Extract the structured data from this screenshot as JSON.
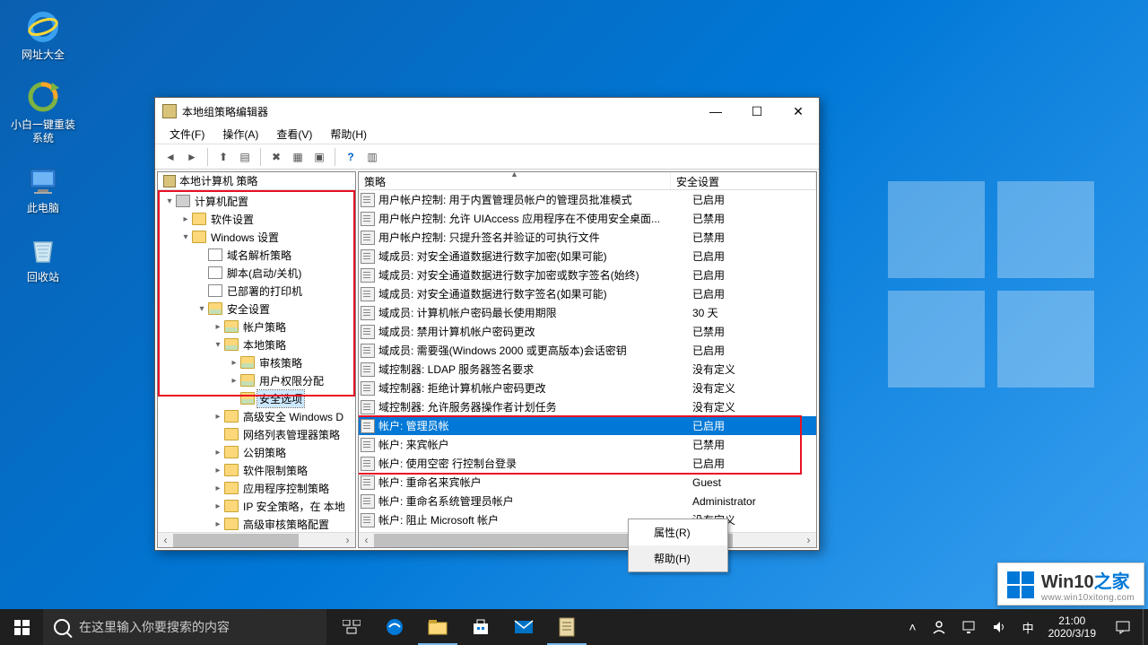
{
  "desktop_icons": [
    {
      "name": "browser",
      "label": "网址大全"
    },
    {
      "name": "reinstall",
      "label": "小白一键重装系统"
    },
    {
      "name": "this-pc",
      "label": "此电脑"
    },
    {
      "name": "recycle-bin",
      "label": "回收站"
    }
  ],
  "window": {
    "title": "本地组策略编辑器",
    "menus": [
      "文件(F)",
      "操作(A)",
      "查看(V)",
      "帮助(H)"
    ]
  },
  "tree": {
    "root": "本地计算机 策略",
    "nodes": [
      {
        "depth": 0,
        "tw": "open",
        "ico": "pc",
        "label": "计算机配置"
      },
      {
        "depth": 1,
        "tw": "closed",
        "ico": "folder",
        "label": "软件设置"
      },
      {
        "depth": 1,
        "tw": "open",
        "ico": "folder",
        "label": "Windows 设置"
      },
      {
        "depth": 2,
        "tw": "none",
        "ico": "doc",
        "label": "域名解析策略"
      },
      {
        "depth": 2,
        "tw": "none",
        "ico": "doc",
        "label": "脚本(启动/关机)"
      },
      {
        "depth": 2,
        "tw": "none",
        "ico": "doc",
        "label": "已部署的打印机"
      },
      {
        "depth": 2,
        "tw": "open",
        "ico": "sec",
        "label": "安全设置"
      },
      {
        "depth": 3,
        "tw": "closed",
        "ico": "sec",
        "label": "帐户策略"
      },
      {
        "depth": 3,
        "tw": "open",
        "ico": "sec",
        "label": "本地策略"
      },
      {
        "depth": 4,
        "tw": "closed",
        "ico": "sec",
        "label": "审核策略"
      },
      {
        "depth": 4,
        "tw": "closed",
        "ico": "sec",
        "label": "用户权限分配"
      },
      {
        "depth": 4,
        "tw": "none",
        "ico": "sec",
        "label": "安全选项",
        "selected": true
      },
      {
        "depth": 3,
        "tw": "closed",
        "ico": "folder",
        "label": "高级安全 Windows D"
      },
      {
        "depth": 3,
        "tw": "none",
        "ico": "folder",
        "label": "网络列表管理器策略"
      },
      {
        "depth": 3,
        "tw": "closed",
        "ico": "folder",
        "label": "公钥策略"
      },
      {
        "depth": 3,
        "tw": "closed",
        "ico": "folder",
        "label": "软件限制策略"
      },
      {
        "depth": 3,
        "tw": "closed",
        "ico": "folder",
        "label": "应用程序控制策略"
      },
      {
        "depth": 3,
        "tw": "closed",
        "ico": "folder",
        "label": "IP 安全策略，在 本地"
      },
      {
        "depth": 3,
        "tw": "closed",
        "ico": "folder",
        "label": "高级审核策略配置"
      }
    ]
  },
  "list": {
    "columns": [
      "策略",
      "安全设置"
    ],
    "rows": [
      {
        "p": "用户帐户控制: 用于内置管理员帐户的管理员批准模式",
        "s": "已启用"
      },
      {
        "p": "用户帐户控制: 允许 UIAccess 应用程序在不使用安全桌面...",
        "s": "已禁用"
      },
      {
        "p": "用户帐户控制: 只提升签名并验证的可执行文件",
        "s": "已禁用"
      },
      {
        "p": "域成员: 对安全通道数据进行数字加密(如果可能)",
        "s": "已启用"
      },
      {
        "p": "域成员: 对安全通道数据进行数字加密或数字签名(始终)",
        "s": "已启用"
      },
      {
        "p": "域成员: 对安全通道数据进行数字签名(如果可能)",
        "s": "已启用"
      },
      {
        "p": "域成员: 计算机帐户密码最长使用期限",
        "s": "30 天"
      },
      {
        "p": "域成员: 禁用计算机帐户密码更改",
        "s": "已禁用"
      },
      {
        "p": "域成员: 需要强(Windows 2000 或更高版本)会话密钥",
        "s": "已启用"
      },
      {
        "p": "域控制器: LDAP 服务器签名要求",
        "s": "没有定义"
      },
      {
        "p": "域控制器: 拒绝计算机帐户密码更改",
        "s": "没有定义"
      },
      {
        "p": "域控制器: 允许服务器操作者计划任务",
        "s": "没有定义"
      },
      {
        "p": "帐户: 管理员帐",
        "s": "已启用",
        "selected": true
      },
      {
        "p": "帐户: 来宾帐户",
        "s": "已禁用"
      },
      {
        "p": "帐户: 使用空密                                      行控制台登录",
        "s": "已启用"
      },
      {
        "p": "帐户: 重命名来宾帐户",
        "s": "Guest"
      },
      {
        "p": "帐户: 重命名系统管理员帐户",
        "s": "Administrator"
      },
      {
        "p": "帐户: 阻止 Microsoft 帐户",
        "s": "没有定义"
      }
    ]
  },
  "context_menu": {
    "items": [
      "属性(R)",
      "帮助(H)"
    ]
  },
  "searchbox": {
    "placeholder": "在这里输入你要搜索的内容"
  },
  "clock": {
    "time": "21:00",
    "date": "2020/3/19"
  },
  "watermark": {
    "brand1": "Win10",
    "brand2": "之家",
    "url": "www.win10xitong.com"
  }
}
